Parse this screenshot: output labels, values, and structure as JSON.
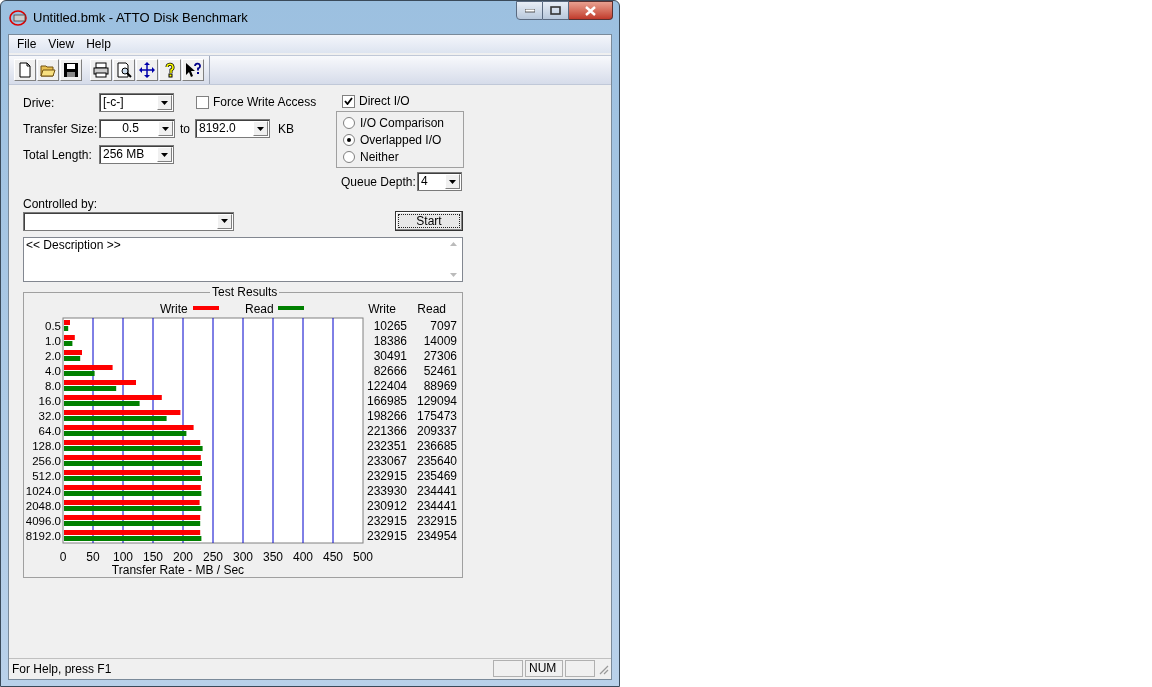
{
  "window": {
    "title": "Untitled.bmk - ATTO Disk Benchmark"
  },
  "menu": [
    "File",
    "View",
    "Help"
  ],
  "toolbar": [
    {
      "kind": "new"
    },
    {
      "kind": "open"
    },
    {
      "kind": "save"
    },
    {
      "kind": "separator"
    },
    {
      "kind": "print"
    },
    {
      "kind": "preview"
    },
    {
      "kind": "move"
    },
    {
      "kind": "help"
    },
    {
      "kind": "context_help"
    }
  ],
  "form": {
    "drive": {
      "label": "Drive:",
      "value": "[-c-]"
    },
    "force_write_access": {
      "label": "Force Write Access",
      "checked": false
    },
    "transfer_size": {
      "label": "Transfer Size:",
      "from": "0.5",
      "to_label": "to",
      "to": "8192.0",
      "unit": "KB"
    },
    "total_length": {
      "label": "Total Length:",
      "value": "256 MB"
    },
    "direct_io": {
      "label": "Direct I/O",
      "checked": true
    },
    "io_mode": [
      {
        "label": "I/O Comparison",
        "selected": false
      },
      {
        "label": "Overlapped I/O",
        "selected": true
      },
      {
        "label": "Neither",
        "selected": false
      }
    ],
    "queue_depth": {
      "label": "Queue Depth:",
      "value": "4"
    },
    "controlled_by": {
      "label": "Controlled by:"
    },
    "start_button": "Start",
    "description": "<< Description >>"
  },
  "test_results": {
    "title": "Test Results",
    "column_headers": [
      "Write",
      "Read"
    ],
    "rows": [
      {
        "write": "10265",
        "read": "7097"
      },
      {
        "write": "18386",
        "read": "14009"
      },
      {
        "write": "30491",
        "read": "27306"
      },
      {
        "write": "82666",
        "read": "52461"
      },
      {
        "write": "122404",
        "read": "88969"
      },
      {
        "write": "166985",
        "read": "129094"
      },
      {
        "write": "198266",
        "read": "175473"
      },
      {
        "write": "221366",
        "read": "209337"
      },
      {
        "write": "232351",
        "read": "236685"
      },
      {
        "write": "233067",
        "read": "235640"
      },
      {
        "write": "232915",
        "read": "235469"
      },
      {
        "write": "233930",
        "read": "234441"
      },
      {
        "write": "230912",
        "read": "234441"
      },
      {
        "write": "232915",
        "read": "232915"
      },
      {
        "write": "232915",
        "read": "234954"
      }
    ],
    "chart_data": {
      "type": "bar",
      "orientation": "horizontal",
      "xlabel": "Transfer Rate - MB / Sec",
      "categories": [
        "0.5",
        "1.0",
        "2.0",
        "4.0",
        "8.0",
        "16.0",
        "32.0",
        "64.0",
        "128.0",
        "256.0",
        "512.0",
        "1024.0",
        "2048.0",
        "4096.0",
        "8192.0"
      ],
      "series": [
        {
          "name": "Write",
          "color": "#ff0000",
          "values": [
            10,
            18,
            30,
            81,
            120,
            163,
            194,
            216,
            227,
            228,
            227,
            228,
            226,
            227,
            227
          ]
        },
        {
          "name": "Read",
          "color": "#008000",
          "values": [
            7,
            14,
            27,
            51,
            87,
            126,
            171,
            204,
            231,
            230,
            230,
            229,
            229,
            227,
            229
          ]
        }
      ],
      "xlim": [
        0,
        500
      ],
      "xticks": [
        0,
        50,
        100,
        150,
        200,
        250,
        300,
        350,
        400,
        450,
        500
      ],
      "grid": true,
      "legend": true
    }
  },
  "status_bar": {
    "text": "For Help, press F1",
    "indicators": [
      "NUM"
    ]
  }
}
